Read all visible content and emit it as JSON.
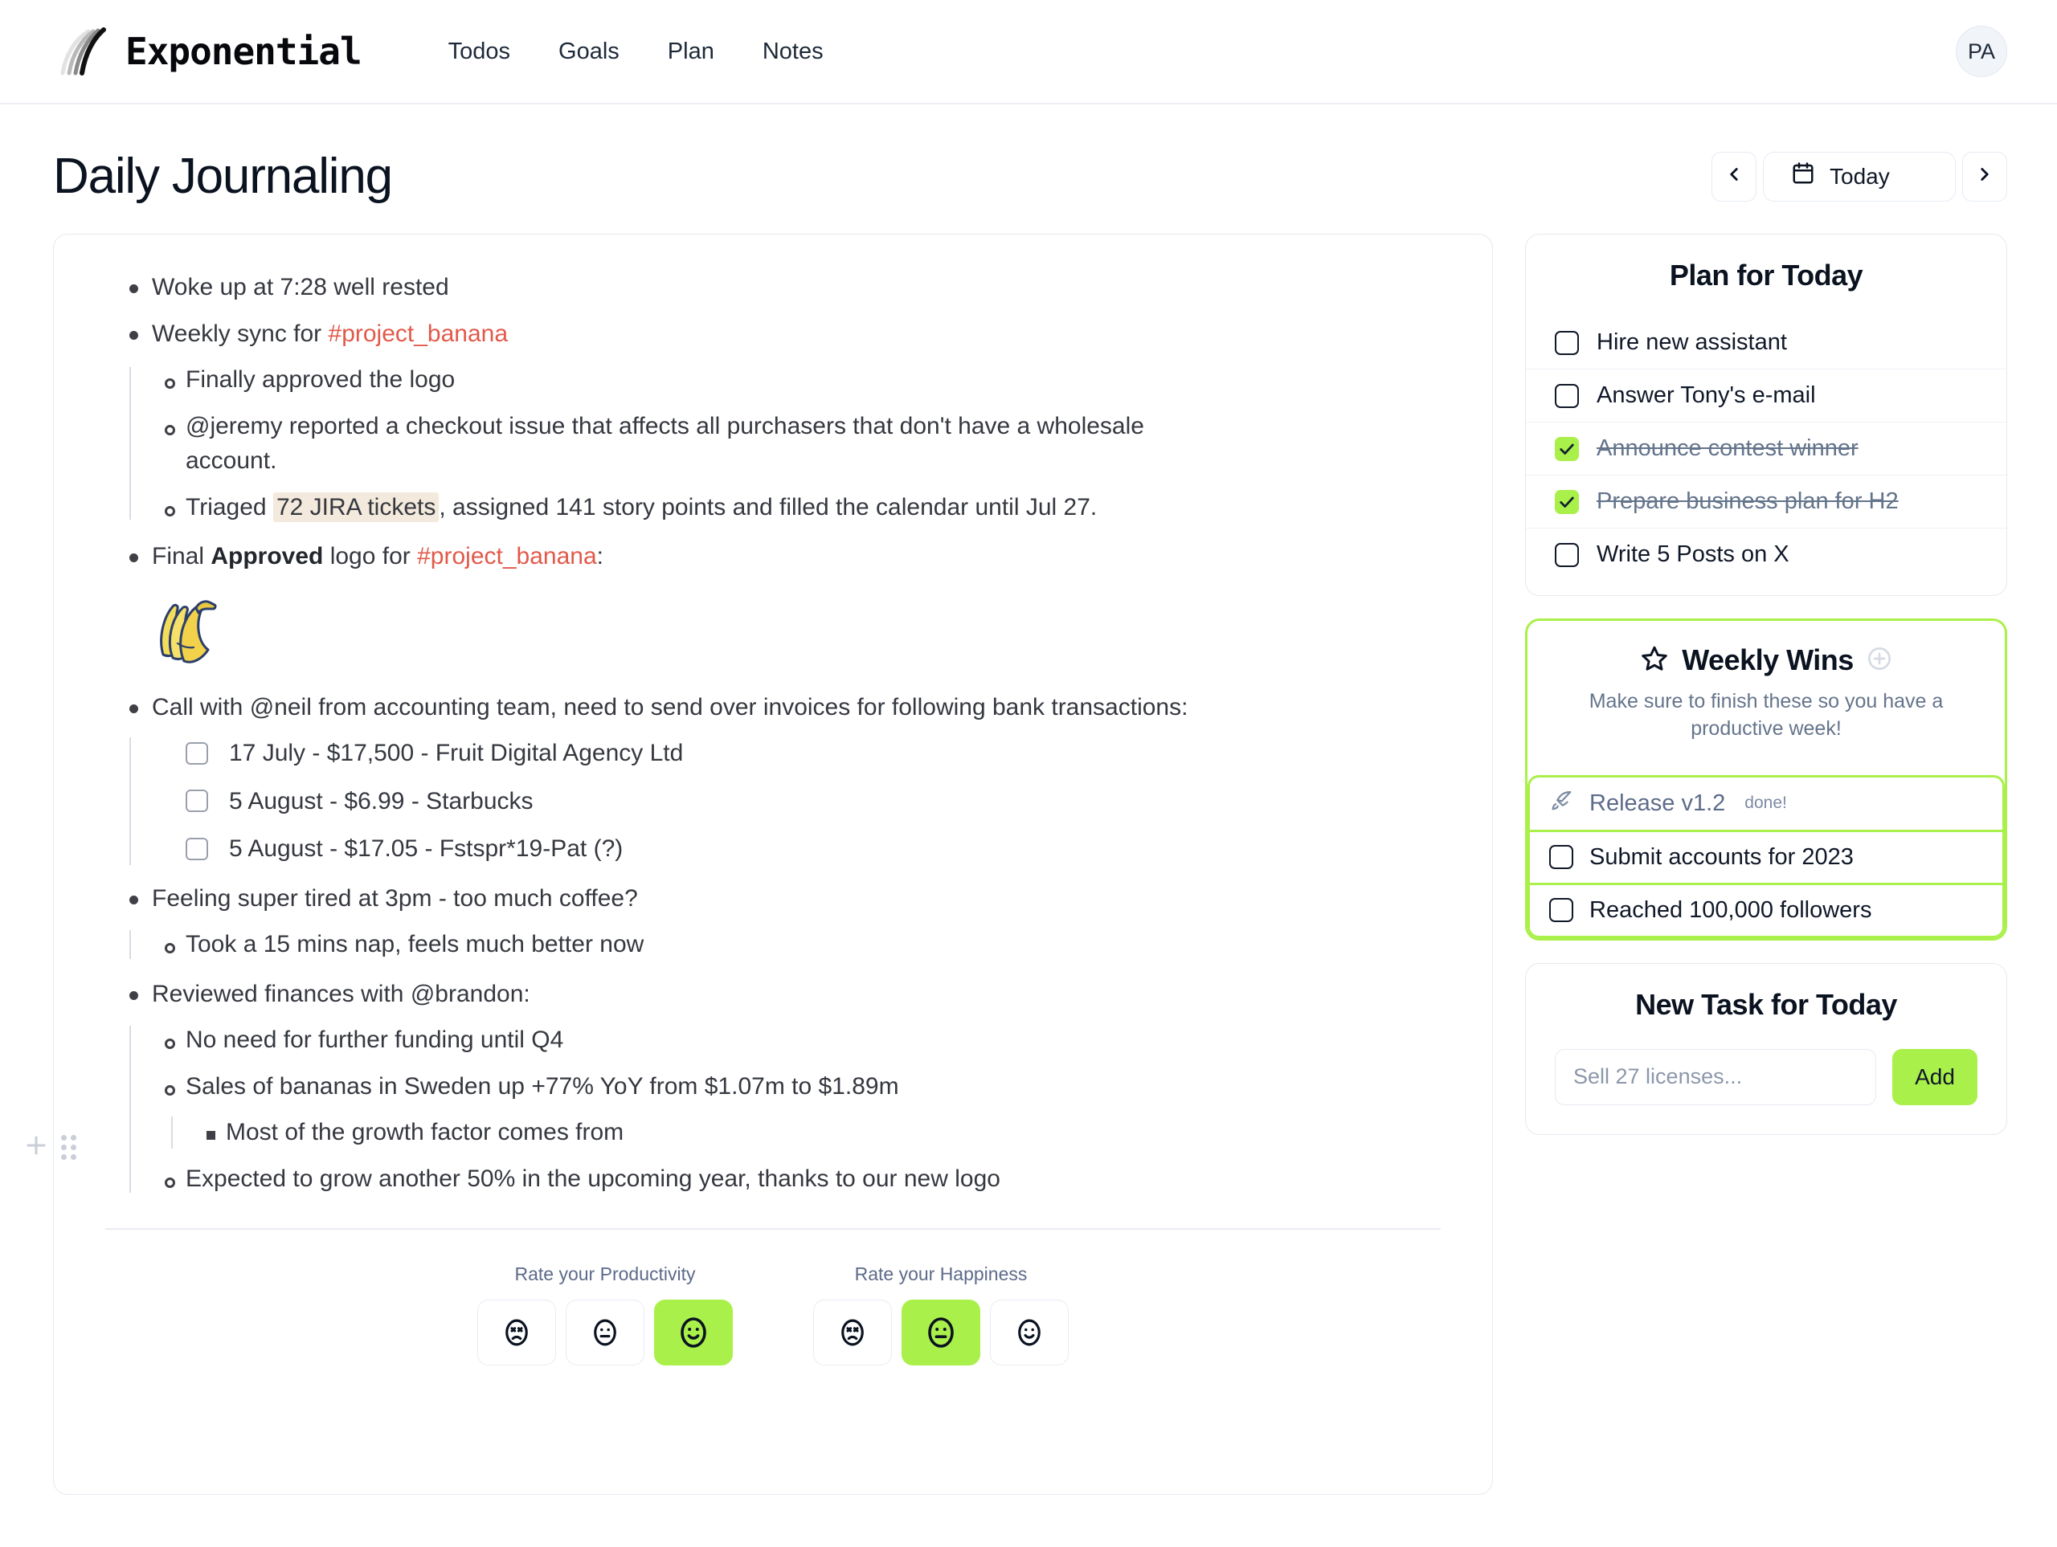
{
  "app": {
    "brand_name": "Exponential",
    "logo_icon": "exponential-curve-logo",
    "nav_items": [
      "Todos",
      "Goals",
      "Plan",
      "Notes"
    ],
    "avatar_initials": "PA"
  },
  "page": {
    "title": "Daily Journaling",
    "date_nav": {
      "prev_icon": "chevron-left-icon",
      "next_icon": "chevron-right-icon",
      "calendar_icon": "calendar-icon",
      "today_label": "Today"
    }
  },
  "journal": {
    "entries": [
      {
        "level": 1,
        "kind": "bullet",
        "text": "Woke up at 7:28 well rested"
      },
      {
        "level": 1,
        "kind": "bullet",
        "prefix": "Weekly sync for ",
        "tag": "#project_banana"
      },
      {
        "level": 2,
        "kind": "bullet",
        "text": "Finally approved the logo"
      },
      {
        "level": 2,
        "kind": "bullet",
        "text": "@jeremy reported a checkout issue that affects all purchasers that don't have a wholesale account."
      },
      {
        "level": 2,
        "kind": "bullet",
        "prefix": "Triaged ",
        "highlight": "72 JIRA tickets",
        "suffix": ", assigned 141 story points and filled the calendar until Jul 27."
      },
      {
        "level": 1,
        "kind": "bullet",
        "prefix": "Final ",
        "bold": "Approved",
        "mid": " logo for ",
        "tag": "#project_banana",
        "suffix": ":"
      },
      {
        "level": 1,
        "kind": "image",
        "image": "banana-bunch-emoji"
      },
      {
        "level": 1,
        "kind": "bullet",
        "text": "Call with @neil from accounting team, need to send over invoices for following bank transactions:"
      },
      {
        "level": 2,
        "kind": "checkbox",
        "checked": false,
        "text": "17 July - $17,500 - Fruit Digital Agency Ltd"
      },
      {
        "level": 2,
        "kind": "checkbox",
        "checked": false,
        "text": "5 August - $6.99 - Starbucks"
      },
      {
        "level": 2,
        "kind": "checkbox",
        "checked": false,
        "text": "5 August - $17.05 - Fstspr*19-Pat (?)"
      },
      {
        "level": 1,
        "kind": "bullet",
        "text": "Feeling super tired at 3pm - too much coffee?"
      },
      {
        "level": 2,
        "kind": "bullet",
        "text": "Took a 15 mins nap, feels much better now"
      },
      {
        "level": 1,
        "kind": "bullet",
        "text": "Reviewed finances with @brandon:"
      },
      {
        "level": 2,
        "kind": "bullet",
        "text": "No need for further funding until Q4"
      },
      {
        "level": 2,
        "kind": "bullet",
        "text": "Sales of bananas in Sweden up +77% YoY from $1.07m to $1.89m"
      },
      {
        "level": 3,
        "kind": "bullet",
        "text": "Most of the growth factor comes from"
      },
      {
        "level": 2,
        "kind": "bullet",
        "text": "Expected to grow another 50% in the upcoming year, thanks to our new logo"
      }
    ],
    "gutter": {
      "add_icon": "plus-icon",
      "drag_icon": "drag-handle-icon"
    }
  },
  "ratings": [
    {
      "label": "Rate your Productivity",
      "options": [
        {
          "icon": "face-sad-icon",
          "selected": false
        },
        {
          "icon": "face-neutral-icon",
          "selected": false
        },
        {
          "icon": "face-happy-icon",
          "selected": true
        }
      ]
    },
    {
      "label": "Rate your Happiness",
      "options": [
        {
          "icon": "face-sad-icon",
          "selected": false
        },
        {
          "icon": "face-neutral-icon",
          "selected": true
        },
        {
          "icon": "face-happy-icon",
          "selected": false
        }
      ]
    }
  ],
  "plan_for_today": {
    "title": "Plan for Today",
    "items": [
      {
        "label": "Hire new assistant",
        "done": false
      },
      {
        "label": "Answer Tony's e-mail",
        "done": false
      },
      {
        "label": "Announce contest winner",
        "done": true
      },
      {
        "label": "Prepare business plan for H2",
        "done": true
      },
      {
        "label": "Write 5 Posts on X",
        "done": false
      }
    ]
  },
  "weekly_wins": {
    "title": "Weekly Wins",
    "star_icon": "star-icon",
    "add_icon": "plus-circle-icon",
    "subtitle": "Make sure to finish these so you have a productive week!",
    "items": [
      {
        "label": "Release v1.2",
        "note": "done!",
        "icon": "rocket-icon",
        "done": true
      },
      {
        "label": "Submit accounts for 2023",
        "note": "",
        "icon": "checkbox-icon",
        "done": false
      },
      {
        "label": "Reached 100,000 followers",
        "note": "",
        "icon": "checkbox-icon",
        "done": false
      }
    ]
  },
  "new_task": {
    "title": "New Task for Today",
    "placeholder": "Sell 27 licenses...",
    "value": "",
    "add_label": "Add"
  },
  "colors": {
    "accent_green": "#aaf04a",
    "tag_red": "#e2594a",
    "highlight_beige": "#f3e9dc",
    "muted_text": "#64748b",
    "border": "#e5e9f0"
  }
}
